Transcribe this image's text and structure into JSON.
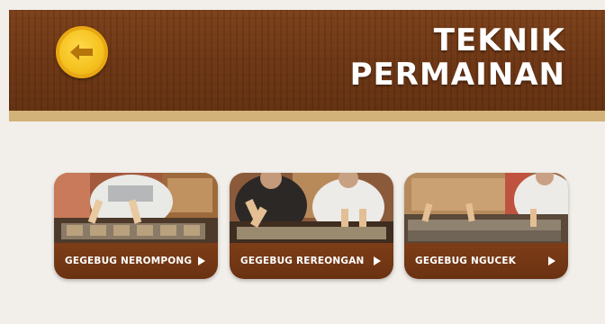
{
  "header": {
    "title_line1": "TEKNIK",
    "title_line2": "PERMAINAN",
    "back_icon": "arrow-left-icon",
    "wood_color": "#6c3513",
    "stripe_color": "#d3b27a",
    "button_color": "#f5c21f"
  },
  "cards": [
    {
      "label": "GEGEBUG NEROMPONG",
      "icon": "play-icon"
    },
    {
      "label": "GEGEBUG REREONGAN",
      "icon": "play-icon"
    },
    {
      "label": "GEGEBUG NGUCEK",
      "icon": "play-icon"
    }
  ]
}
